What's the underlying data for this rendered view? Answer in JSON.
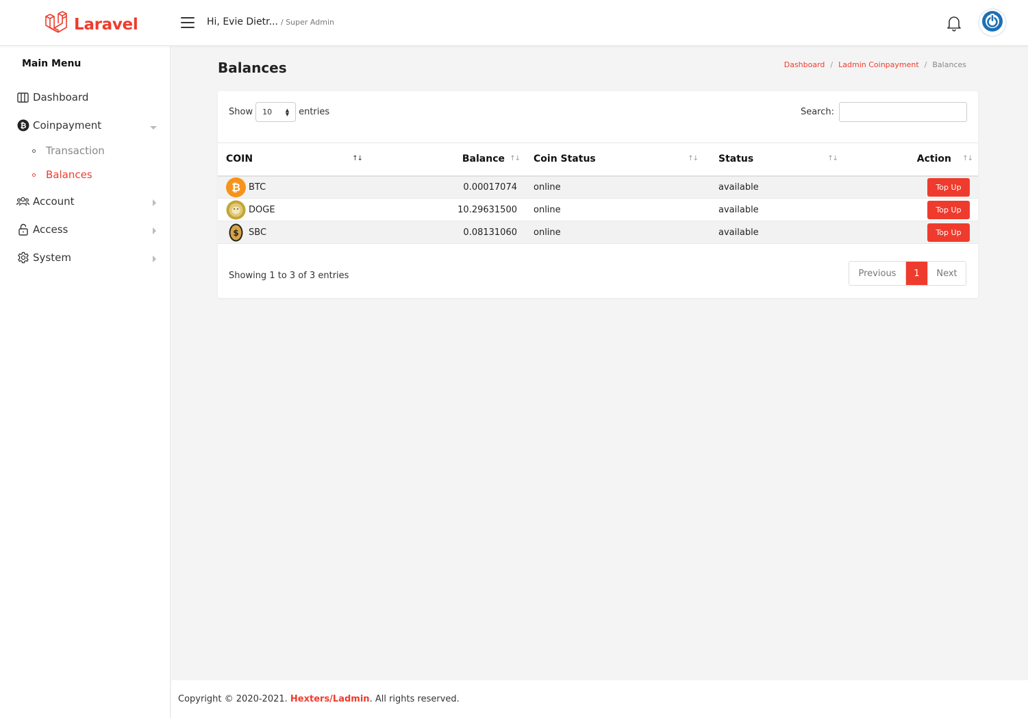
{
  "header": {
    "logo_text": "Laravel",
    "greeting": "Hi, Evie Dietr...",
    "role": "/ Super Admin",
    "brand_color": "#ef3b2d"
  },
  "sidebar": {
    "title": "Main Menu",
    "items": [
      {
        "label": "Dashboard",
        "icon": "columns-icon"
      },
      {
        "label": "Coinpayment",
        "icon": "bitcoin-icon",
        "expanded": true
      },
      {
        "label": "Account",
        "icon": "users-icon"
      },
      {
        "label": "Access",
        "icon": "unlock-icon"
      },
      {
        "label": "System",
        "icon": "gear-icon"
      }
    ],
    "sub_items": [
      {
        "label": "Transaction",
        "active": false
      },
      {
        "label": "Balances",
        "active": true
      }
    ]
  },
  "page": {
    "title": "Balances",
    "breadcrumb": [
      "Dashboard",
      "Ladmin Coinpayment",
      "Balances"
    ]
  },
  "table": {
    "show_label": "Show",
    "entries_label": "entries",
    "page_length": "10",
    "search_label": "Search:",
    "columns": [
      "COIN",
      "Balance",
      "Coin Status",
      "Status",
      "Action"
    ],
    "rows": [
      {
        "coin": "BTC",
        "icon": "btc-icon",
        "balance": "0.00017074",
        "coin_status": "online",
        "status": "available",
        "action": "Top Up"
      },
      {
        "coin": "DOGE",
        "icon": "doge-icon",
        "balance": "10.29631500",
        "coin_status": "online",
        "status": "available",
        "action": "Top Up"
      },
      {
        "coin": "SBC",
        "icon": "sbc-icon",
        "balance": "0.08131060",
        "coin_status": "online",
        "status": "available",
        "action": "Top Up"
      }
    ],
    "info": "Showing 1 to 3 of 3 entries",
    "pagination": {
      "previous": "Previous",
      "current": "1",
      "next": "Next"
    }
  },
  "footer": {
    "prefix": "Copyright © 2020-2021.",
    "brand": "Hexters/Ladmin",
    "suffix": ". All rights reserved."
  }
}
